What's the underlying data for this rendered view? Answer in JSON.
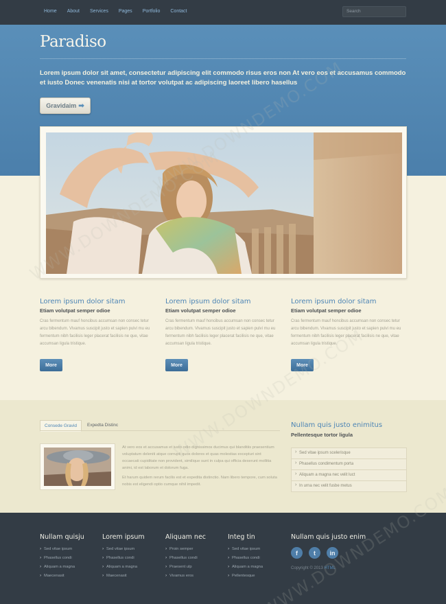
{
  "nav": {
    "items": [
      "Home",
      "About",
      "Services",
      "Pages",
      "Portfolio",
      "Contact"
    ],
    "search_placeholder": "Search"
  },
  "hero": {
    "brand": "Paradiso",
    "tagline": "Lorem ipsum dolor sit amet, consectetur adipiscing elit commodo risus eros non At vero eos et accusamus commodo et iusto Donec venenatis nisi at tortor volutpat ac adipiscing laoreet libero hasellus",
    "cta_label": "Gravidaim"
  },
  "columns": [
    {
      "title": "Lorem ipsum dolor sitam",
      "subtitle": "Etiam volutpat semper odioe",
      "body": "Cras fermentum mauf honcibus accumsan non consec tetur arcu bibendum. Vivamus suscipit justo et sapien pulvi mu eu fermentum nibh facilisis leger placerat facilisis ne que, vitae accumsan ligula tristique.",
      "button": "More"
    },
    {
      "title": "Lorem ipsum dolor sitam",
      "subtitle": "Etiam volutpat semper odioe",
      "body": "Cras fermentum mauf honcibus accumsan non consec tetur arcu bibendum. Vivamus suscipit justo et sapien pulvi mu eu fermentum nibh facilisis leger placerat facilisis ne que, vitae accumsan ligula tristique.",
      "button": "More"
    },
    {
      "title": "Lorem ipsum dolor sitam",
      "subtitle": "Etiam volutpat semper odioe",
      "body": "Cras fermentum mauf honcibus accumsan non consec tetur arcu bibendum. Vivamus suscipit justo et sapien pulvi mu eu fermentum nibh facilisis leger placerat facilisis ne que, vitae accumsan ligula tristique.",
      "button": "More"
    }
  ],
  "tabs": {
    "items": [
      "Consede Gravid",
      "Expedta Distinc"
    ],
    "active": 0,
    "paragraph1": "At vero eos et accusamus et iusto odio dignissimos ducimus qui blanditiis praesentium voluptatum deleniti atque corrupti quos dolores et quas molestias excepturi sint occaecati cupiditate non provident, similique sunt in culpa qui officia deserunt mollitia animi, id est laborum et dolorum fuga.",
    "paragraph2": "Et harum quidem rerum facilis est et expedita distinctio. Nam libero tempore, cum soluta nobis est eligendi optio cumque nihil impedit."
  },
  "sidebar": {
    "title": "Nullam quis justo enimitus",
    "subtitle": "Pellentesque tortor ligula",
    "items": [
      "Sed vitae ipsum scelerisque",
      "Phasellus condimentum porta",
      "Aliquam a magna nec velit luct",
      "In urna nec velit fusbe metus"
    ]
  },
  "footer": {
    "columns": [
      {
        "title": "Nullam quisju",
        "items": [
          "Sed vitae ipsum",
          "Phasellus condi",
          "Aliquam a magna",
          "Maecenasit"
        ]
      },
      {
        "title": "Lorem ipsum",
        "items": [
          "Sed vitae ipsum",
          "Phasellus condi",
          "Aliquam a magna",
          "Maecenasit"
        ]
      },
      {
        "title": "Aliquam nec",
        "items": [
          "Proin semper",
          "Phasellus condi",
          "Praesent ulp",
          "Vivamus eros"
        ]
      },
      {
        "title": "Integ tin",
        "items": [
          "Sed vitae ipsum",
          "Phasellus condi",
          "Aliquam a magna",
          "Pellentesque"
        ]
      }
    ],
    "social_title": "Nullam quis justo enim",
    "social": [
      "f",
      "t",
      "in"
    ],
    "copyright_prefix": "Copyright © 2013",
    "copyright_link": "HTML"
  },
  "watermark": "WWW.DOWNDEMO.COM"
}
